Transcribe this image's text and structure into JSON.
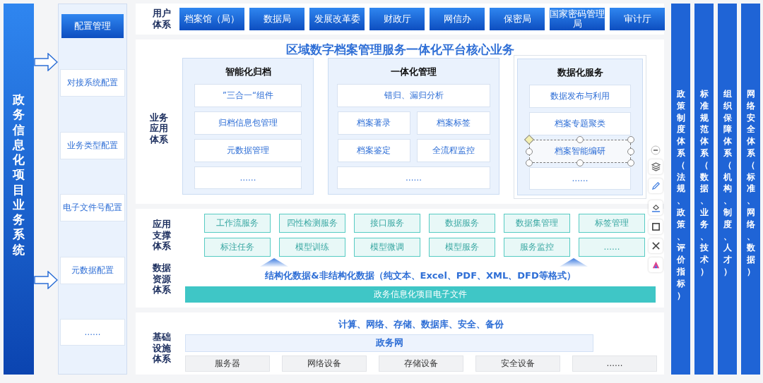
{
  "left_bar": {
    "title": "政务信息化项目业务系统"
  },
  "config": {
    "title": "配置管理",
    "items": [
      "对接系统配置",
      "业务类型配置",
      "电子文件号配置",
      "元数据配置",
      "……"
    ]
  },
  "users": {
    "label": "用户体系",
    "items": [
      "档案馆（局）",
      "数据局",
      "发展改革委",
      "财政厅",
      "网信办",
      "保密局",
      "国家密码管理局",
      "审计厅"
    ]
  },
  "core": {
    "title": "区域数字档案管理服务一体化平台核心业务",
    "label": "业务应用体系",
    "groups": [
      {
        "title": "智能化归档",
        "items": [
          {
            "text": "”三合一“组件",
            "kind": "wide",
            "selected": false
          },
          {
            "text": "归档信息包管理",
            "kind": "wide",
            "selected": false
          },
          {
            "text": "元数据管理",
            "kind": "wide",
            "selected": false
          },
          {
            "text": "……",
            "kind": "wide",
            "selected": false
          }
        ]
      },
      {
        "title": "一体化管理",
        "items": [
          {
            "text": "错归、漏归分析",
            "kind": "wide",
            "selected": false
          },
          {
            "text": "档案著录",
            "kind": "half",
            "selected": false
          },
          {
            "text": "档案标签",
            "kind": "half",
            "selected": false
          },
          {
            "text": "档案鉴定",
            "kind": "half",
            "selected": false
          },
          {
            "text": "全流程监控",
            "kind": "half",
            "selected": false
          },
          {
            "text": "……",
            "kind": "wide",
            "selected": false
          }
        ]
      },
      {
        "title": "数据化服务",
        "items": [
          {
            "text": "数据发布与利用",
            "kind": "wide",
            "selected": false
          },
          {
            "text": "档案专题聚类",
            "kind": "wide",
            "selected": false
          },
          {
            "text": "档案智能编研",
            "kind": "wide",
            "selected": true
          },
          {
            "text": "……",
            "kind": "wide",
            "selected": false
          }
        ]
      }
    ]
  },
  "support": {
    "label": "应用支撑体系",
    "items": [
      "工作流服务",
      "四性检测服务",
      "接口服务",
      "数据服务",
      "数据集管理",
      "标签管理",
      "标注任务",
      "模型训练",
      "模型微调",
      "模型服务",
      "服务监控",
      "……"
    ]
  },
  "data": {
    "label": "数据资源体系",
    "formats": "结构化数据&非结构化数据（纯文本、Excel、PDF、XML、DFD等格式）",
    "bar": "政务信息化项目电子文件"
  },
  "infra": {
    "label": "基础设施体系",
    "summary": "计算、网络、存储、数据库、安全、备份",
    "network": "政务网",
    "devices": [
      "服务器",
      "网络设备",
      "存储设备",
      "安全设备",
      "……"
    ]
  },
  "pillars": [
    "政策制度体系（法规、政策、评价指标）",
    "标准规范体系（数据、业务、技术）",
    "组织保障体系（机构、制度、人才）",
    "网络安全体系（标准、网络、数据）"
  ]
}
